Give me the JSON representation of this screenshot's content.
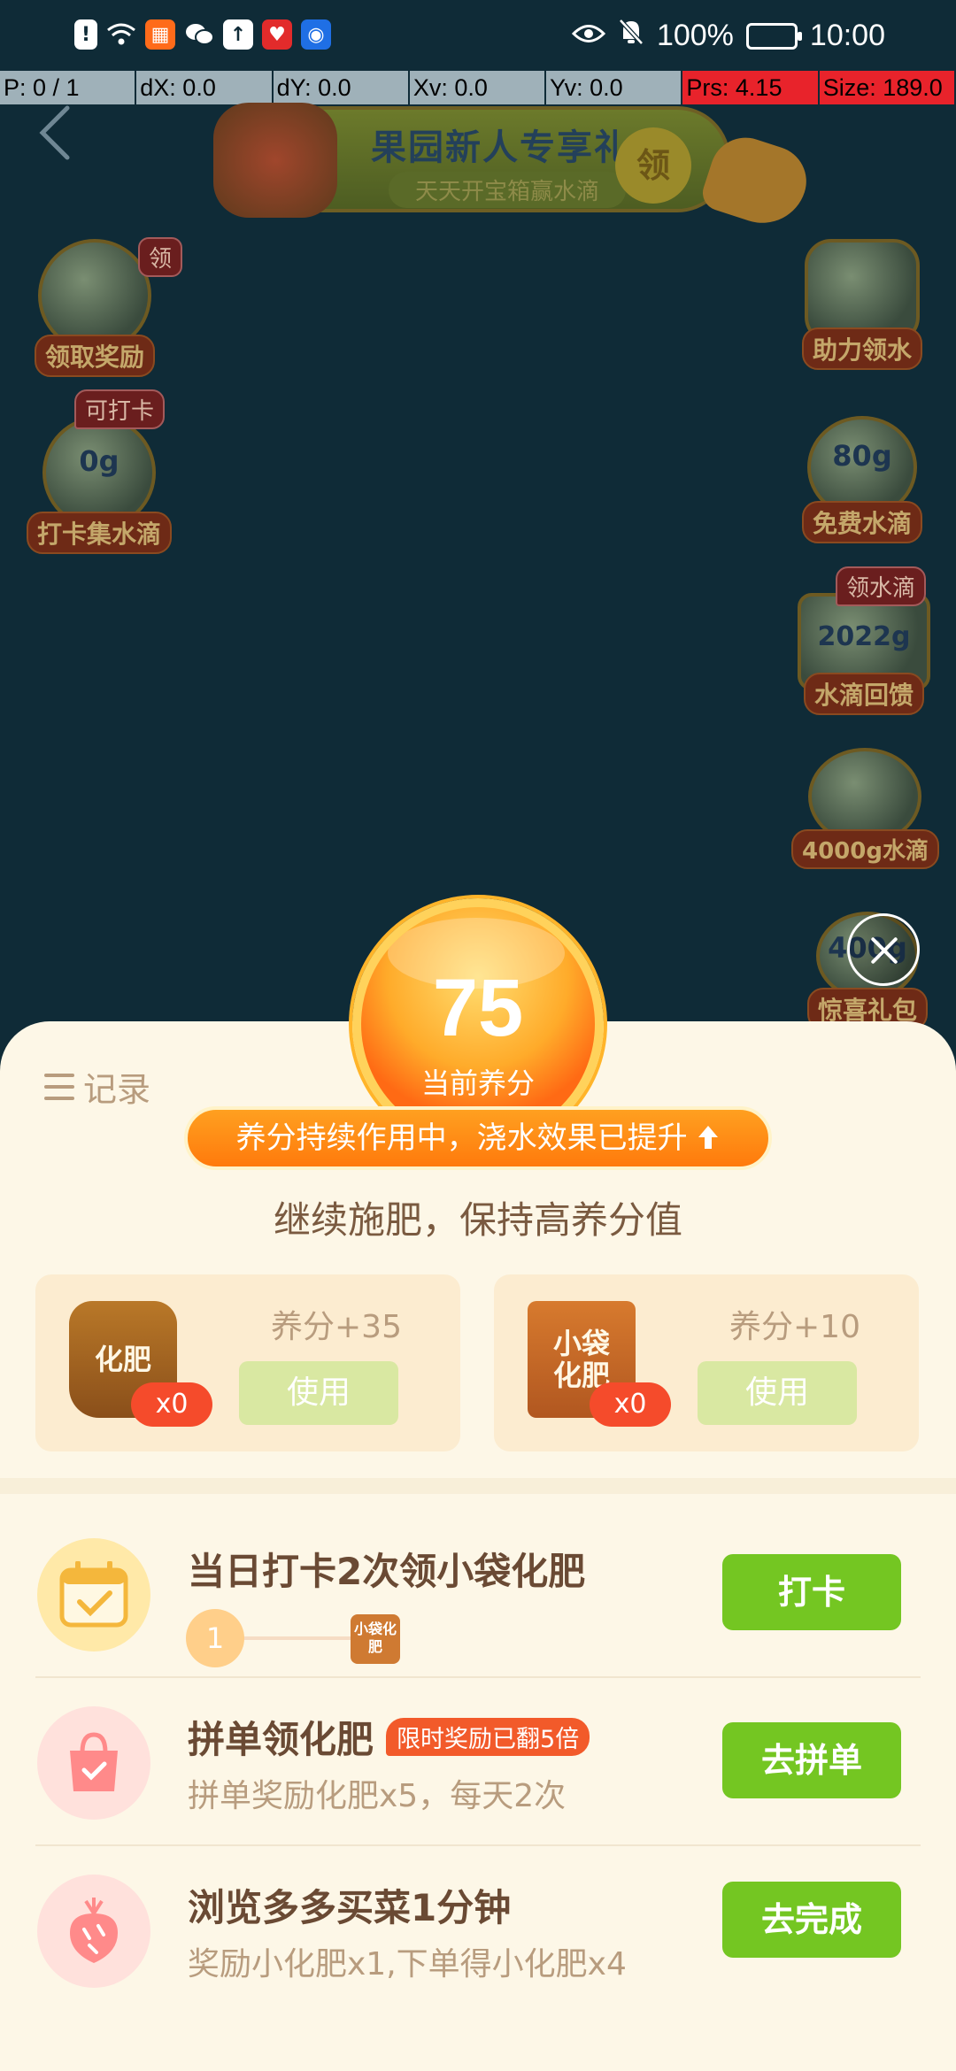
{
  "status_bar": {
    "battery": "100%",
    "time": "10:00"
  },
  "debug_bar": {
    "p": "P: 0 / 1",
    "dx": "dX: 0.0",
    "dy": "dY: 0.0",
    "xv": "Xv: 0.0",
    "yv": "Yv: 0.0",
    "prs": "Prs: 4.15",
    "size": "Size: 189.0"
  },
  "game": {
    "banner_title": "果园新人专享礼",
    "banner_subtitle": "天天开宝箱赢水滴",
    "banner_claim": "领",
    "left_items": [
      {
        "label": "领取奖励",
        "badge": "领"
      },
      {
        "label": "打卡集水滴",
        "badge": "可打卡",
        "value": "0g"
      }
    ],
    "right_items": [
      {
        "label": "助力领水"
      },
      {
        "label": "免费水滴",
        "value": "80g"
      },
      {
        "label": "水滴回馈",
        "badge": "领水滴",
        "value": "2022g"
      },
      {
        "label": "4000g水滴"
      },
      {
        "label": "惊喜礼包",
        "value": "400g"
      }
    ]
  },
  "sheet": {
    "score_value": "75",
    "score_label": "当前养分",
    "record_label": "记录",
    "boost_text": "养分持续作用中，浇水效果已提升",
    "subtitle": "继续施肥，保持高养分值",
    "fertilizers": [
      {
        "sack_text": "化肥",
        "count": "x0",
        "score": "养分+35",
        "button": "使用"
      },
      {
        "sack_text": "小袋化肥",
        "count": "x0",
        "score": "养分+10",
        "button": "使用"
      }
    ],
    "tasks": [
      {
        "title": "当日打卡2次领小袋化肥",
        "progress_step": "1",
        "progress_reward": "小袋化肥",
        "button": "打卡"
      },
      {
        "title": "拼单领化肥",
        "badge": "限时奖励已翻5倍",
        "desc": "拼单奖励化肥x5，每天2次",
        "button": "去拼单"
      },
      {
        "title": "浏览多多买菜1分钟",
        "desc": "奖励小化肥x1,下单得小化肥x4",
        "button": "去完成"
      }
    ]
  }
}
